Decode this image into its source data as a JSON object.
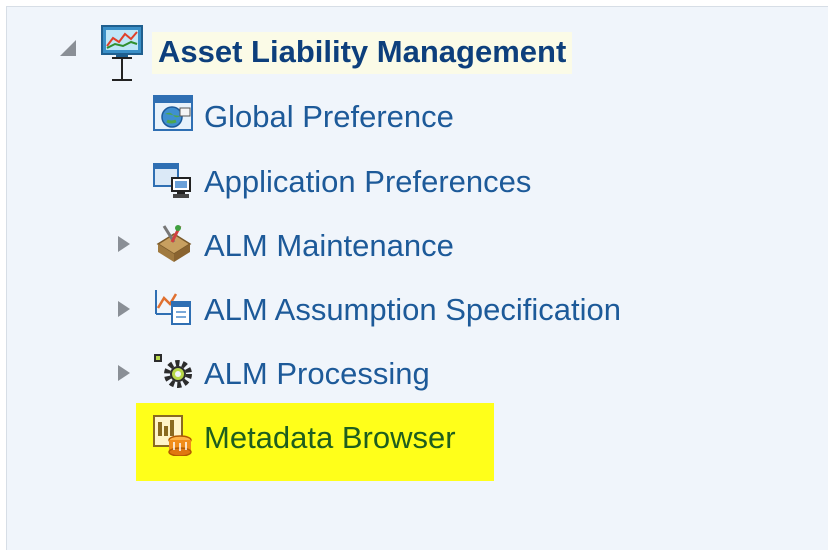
{
  "tree": {
    "root": {
      "label": "Asset Liability Management",
      "icon": "alm-monitor-chart-icon",
      "expanded": true
    },
    "items": [
      {
        "label": "Global Preference",
        "icon": "globe-window-icon",
        "expandable": false
      },
      {
        "label": "Application Preferences",
        "icon": "windows-computer-icon",
        "expandable": false
      },
      {
        "label": "ALM Maintenance",
        "icon": "tools-maintenance-icon",
        "expandable": true
      },
      {
        "label": "ALM Assumption Specification",
        "icon": "chart-document-icon",
        "expandable": true
      },
      {
        "label": "ALM Processing",
        "icon": "gear-process-icon",
        "expandable": true
      },
      {
        "label": "Metadata Browser",
        "icon": "database-report-icon",
        "expandable": false,
        "highlighted": true
      }
    ]
  },
  "colors": {
    "panel_bg": "#f0f5fb",
    "link_text": "#1d5a99",
    "root_text": "#0d3f7c",
    "highlight": "#ffff1a"
  }
}
